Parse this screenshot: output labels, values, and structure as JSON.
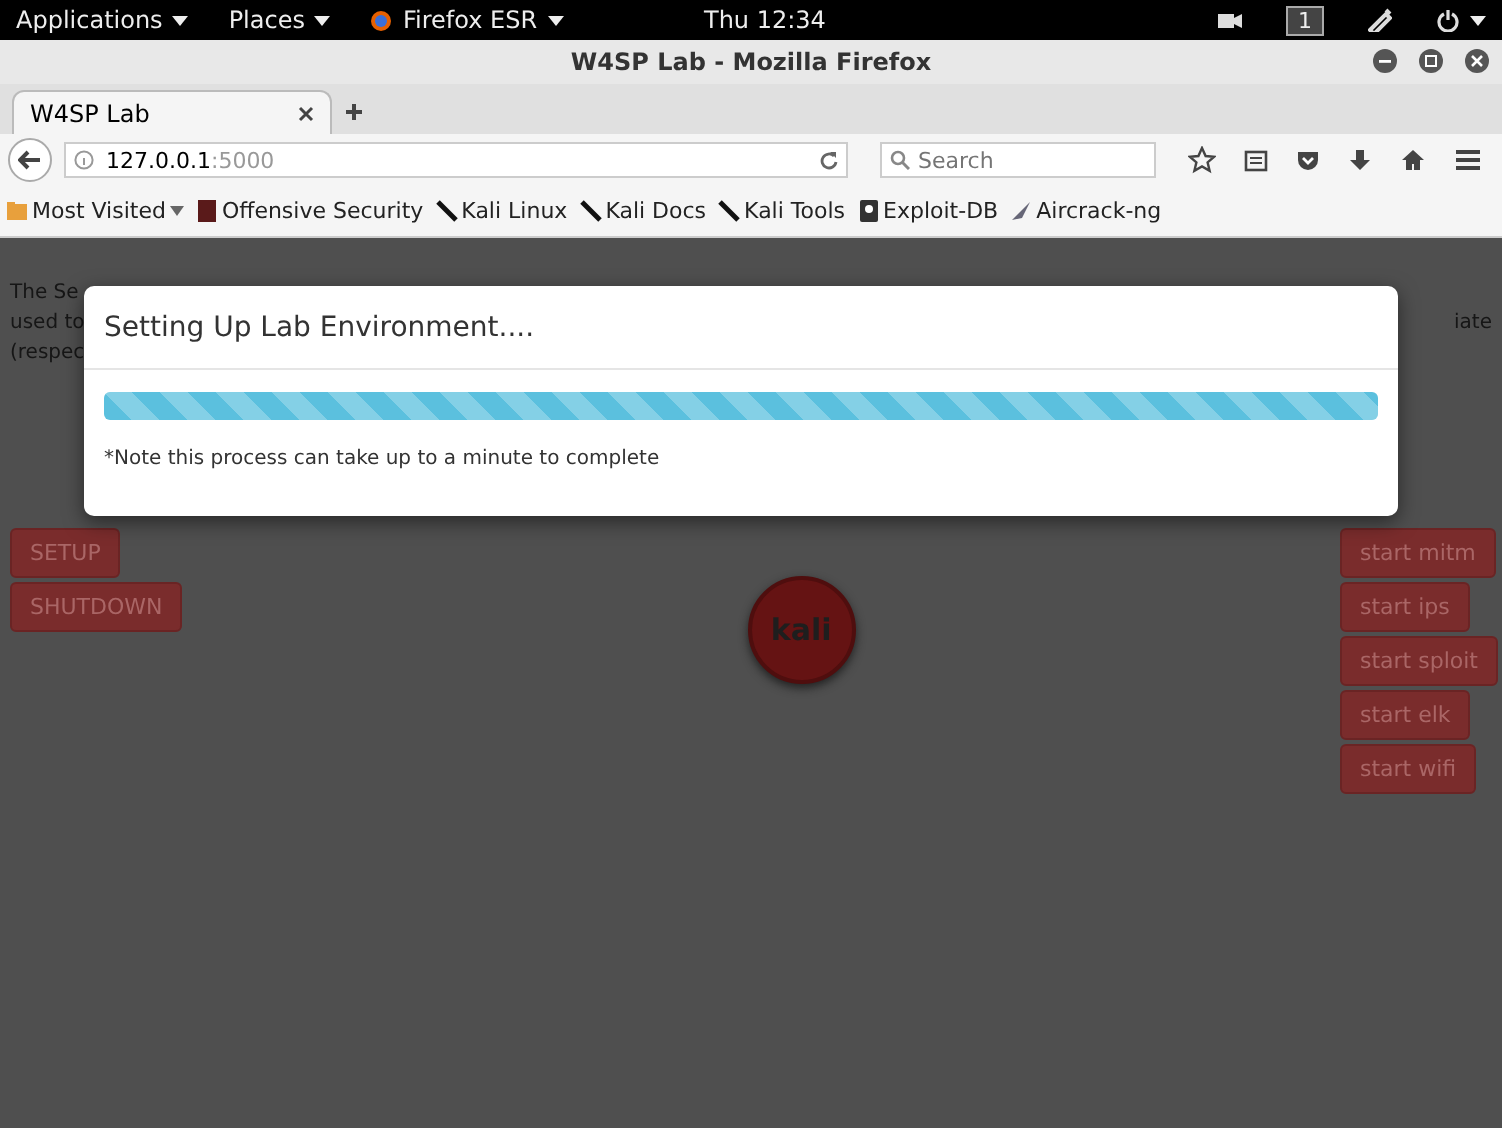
{
  "top_bar": {
    "menus": [
      "Applications",
      "Places",
      "Firefox ESR"
    ],
    "clock": "Thu 12:34",
    "workspace": "1"
  },
  "window": {
    "title": "W4SP Lab - Mozilla Firefox"
  },
  "tabs": [
    {
      "label": "W4SP Lab",
      "selected": true
    }
  ],
  "address_bar": {
    "host": "127.0.0.1",
    "port": ":5000"
  },
  "search": {
    "placeholder": "Search"
  },
  "bookmarks": [
    "Most Visited",
    "Offensive Security",
    "Kali Linux",
    "Kali Docs",
    "Kali Tools",
    "Exploit-DB",
    "Aircrack-ng"
  ],
  "page": {
    "intro_left": [
      "The Se",
      "used to",
      "(respec"
    ],
    "intro_right": "iate",
    "left_buttons": [
      "SETUP",
      "SHUTDOWN"
    ],
    "node": "kali",
    "right_buttons": [
      "start mitm",
      "start ips",
      "start sploit",
      "start elk",
      "start wifi"
    ]
  },
  "modal": {
    "title": "Setting Up Lab Environment....",
    "level": 1,
    "note": "*Note this process can take up to a minute to complete"
  }
}
